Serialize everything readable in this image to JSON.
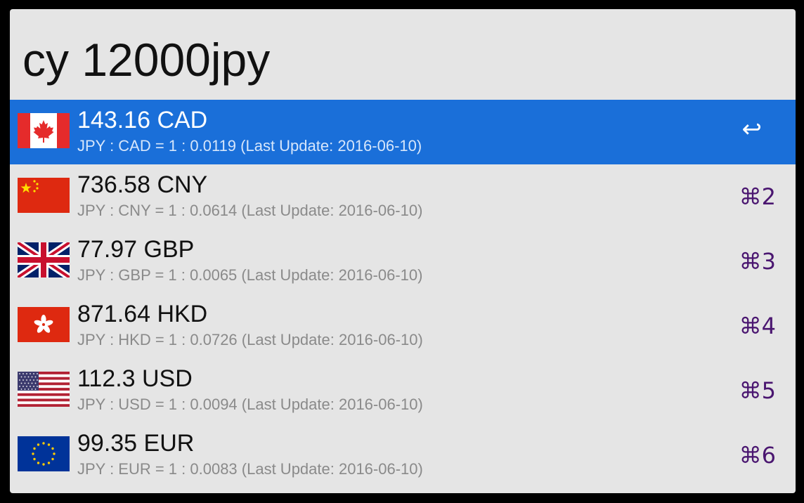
{
  "search": {
    "query": "cy 12000jpy"
  },
  "colors": {
    "window_bg": "#e5e5e5",
    "selected_row": "#1a6fd9",
    "shortcut_text": "#4a1670",
    "subtitle_text": "#8a8a8a"
  },
  "results": [
    {
      "title": "143.16 CAD",
      "subtitle": "JPY : CAD = 1 : 0.0119 (Last Update: 2016-06-10)",
      "shortcut": "↩",
      "icon": "canada-flag-icon",
      "selected": true
    },
    {
      "title": "736.58 CNY",
      "subtitle": "JPY : CNY = 1 : 0.0614 (Last Update: 2016-06-10)",
      "shortcut": "⌘2",
      "icon": "china-flag-icon",
      "selected": false
    },
    {
      "title": "77.97 GBP",
      "subtitle": "JPY : GBP = 1 : 0.0065 (Last Update: 2016-06-10)",
      "shortcut": "⌘3",
      "icon": "uk-flag-icon",
      "selected": false
    },
    {
      "title": "871.64 HKD",
      "subtitle": "JPY : HKD = 1 : 0.0726 (Last Update: 2016-06-10)",
      "shortcut": "⌘4",
      "icon": "hong-kong-flag-icon",
      "selected": false
    },
    {
      "title": "112.3 USD",
      "subtitle": "JPY : USD = 1 : 0.0094 (Last Update: 2016-06-10)",
      "shortcut": "⌘5",
      "icon": "us-flag-icon",
      "selected": false
    },
    {
      "title": "99.35 EUR",
      "subtitle": "JPY : EUR = 1 : 0.0083 (Last Update: 2016-06-10)",
      "shortcut": "⌘6",
      "icon": "eu-flag-icon",
      "selected": false
    }
  ]
}
